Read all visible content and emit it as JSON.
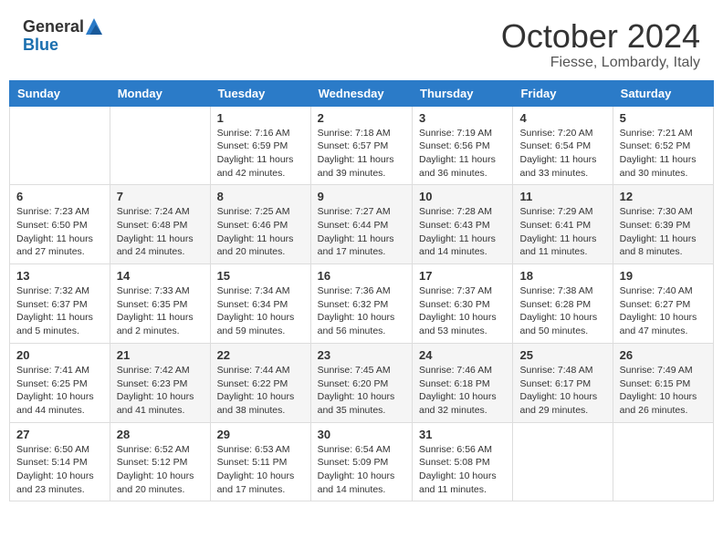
{
  "logo": {
    "general": "General",
    "blue": "Blue"
  },
  "header": {
    "month": "October 2024",
    "location": "Fiesse, Lombardy, Italy"
  },
  "days_of_week": [
    "Sunday",
    "Monday",
    "Tuesday",
    "Wednesday",
    "Thursday",
    "Friday",
    "Saturday"
  ],
  "weeks": [
    [
      {
        "day": "",
        "info": ""
      },
      {
        "day": "",
        "info": ""
      },
      {
        "day": "1",
        "info": "Sunrise: 7:16 AM\nSunset: 6:59 PM\nDaylight: 11 hours and 42 minutes."
      },
      {
        "day": "2",
        "info": "Sunrise: 7:18 AM\nSunset: 6:57 PM\nDaylight: 11 hours and 39 minutes."
      },
      {
        "day": "3",
        "info": "Sunrise: 7:19 AM\nSunset: 6:56 PM\nDaylight: 11 hours and 36 minutes."
      },
      {
        "day": "4",
        "info": "Sunrise: 7:20 AM\nSunset: 6:54 PM\nDaylight: 11 hours and 33 minutes."
      },
      {
        "day": "5",
        "info": "Sunrise: 7:21 AM\nSunset: 6:52 PM\nDaylight: 11 hours and 30 minutes."
      }
    ],
    [
      {
        "day": "6",
        "info": "Sunrise: 7:23 AM\nSunset: 6:50 PM\nDaylight: 11 hours and 27 minutes."
      },
      {
        "day": "7",
        "info": "Sunrise: 7:24 AM\nSunset: 6:48 PM\nDaylight: 11 hours and 24 minutes."
      },
      {
        "day": "8",
        "info": "Sunrise: 7:25 AM\nSunset: 6:46 PM\nDaylight: 11 hours and 20 minutes."
      },
      {
        "day": "9",
        "info": "Sunrise: 7:27 AM\nSunset: 6:44 PM\nDaylight: 11 hours and 17 minutes."
      },
      {
        "day": "10",
        "info": "Sunrise: 7:28 AM\nSunset: 6:43 PM\nDaylight: 11 hours and 14 minutes."
      },
      {
        "day": "11",
        "info": "Sunrise: 7:29 AM\nSunset: 6:41 PM\nDaylight: 11 hours and 11 minutes."
      },
      {
        "day": "12",
        "info": "Sunrise: 7:30 AM\nSunset: 6:39 PM\nDaylight: 11 hours and 8 minutes."
      }
    ],
    [
      {
        "day": "13",
        "info": "Sunrise: 7:32 AM\nSunset: 6:37 PM\nDaylight: 11 hours and 5 minutes."
      },
      {
        "day": "14",
        "info": "Sunrise: 7:33 AM\nSunset: 6:35 PM\nDaylight: 11 hours and 2 minutes."
      },
      {
        "day": "15",
        "info": "Sunrise: 7:34 AM\nSunset: 6:34 PM\nDaylight: 10 hours and 59 minutes."
      },
      {
        "day": "16",
        "info": "Sunrise: 7:36 AM\nSunset: 6:32 PM\nDaylight: 10 hours and 56 minutes."
      },
      {
        "day": "17",
        "info": "Sunrise: 7:37 AM\nSunset: 6:30 PM\nDaylight: 10 hours and 53 minutes."
      },
      {
        "day": "18",
        "info": "Sunrise: 7:38 AM\nSunset: 6:28 PM\nDaylight: 10 hours and 50 minutes."
      },
      {
        "day": "19",
        "info": "Sunrise: 7:40 AM\nSunset: 6:27 PM\nDaylight: 10 hours and 47 minutes."
      }
    ],
    [
      {
        "day": "20",
        "info": "Sunrise: 7:41 AM\nSunset: 6:25 PM\nDaylight: 10 hours and 44 minutes."
      },
      {
        "day": "21",
        "info": "Sunrise: 7:42 AM\nSunset: 6:23 PM\nDaylight: 10 hours and 41 minutes."
      },
      {
        "day": "22",
        "info": "Sunrise: 7:44 AM\nSunset: 6:22 PM\nDaylight: 10 hours and 38 minutes."
      },
      {
        "day": "23",
        "info": "Sunrise: 7:45 AM\nSunset: 6:20 PM\nDaylight: 10 hours and 35 minutes."
      },
      {
        "day": "24",
        "info": "Sunrise: 7:46 AM\nSunset: 6:18 PM\nDaylight: 10 hours and 32 minutes."
      },
      {
        "day": "25",
        "info": "Sunrise: 7:48 AM\nSunset: 6:17 PM\nDaylight: 10 hours and 29 minutes."
      },
      {
        "day": "26",
        "info": "Sunrise: 7:49 AM\nSunset: 6:15 PM\nDaylight: 10 hours and 26 minutes."
      }
    ],
    [
      {
        "day": "27",
        "info": "Sunrise: 6:50 AM\nSunset: 5:14 PM\nDaylight: 10 hours and 23 minutes."
      },
      {
        "day": "28",
        "info": "Sunrise: 6:52 AM\nSunset: 5:12 PM\nDaylight: 10 hours and 20 minutes."
      },
      {
        "day": "29",
        "info": "Sunrise: 6:53 AM\nSunset: 5:11 PM\nDaylight: 10 hours and 17 minutes."
      },
      {
        "day": "30",
        "info": "Sunrise: 6:54 AM\nSunset: 5:09 PM\nDaylight: 10 hours and 14 minutes."
      },
      {
        "day": "31",
        "info": "Sunrise: 6:56 AM\nSunset: 5:08 PM\nDaylight: 10 hours and 11 minutes."
      },
      {
        "day": "",
        "info": ""
      },
      {
        "day": "",
        "info": ""
      }
    ]
  ]
}
